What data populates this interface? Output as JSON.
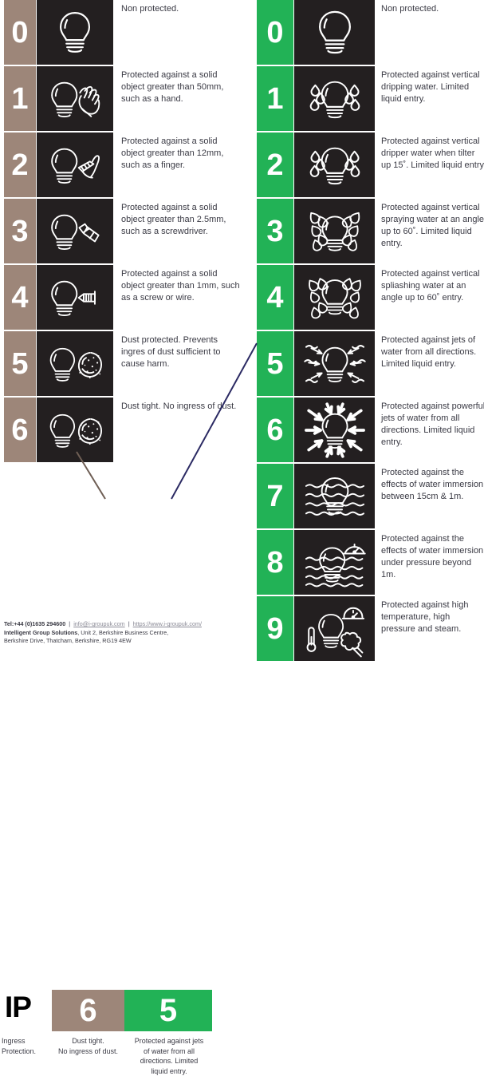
{
  "colors": {
    "brown": "#9d8679",
    "green": "#22b256",
    "tile": "#231f20",
    "text": "#3a3a44",
    "connector_dust": "#6f5f55",
    "connector_water": "#2b2a63",
    "white": "#ffffff",
    "black": "#000000"
  },
  "solids_column": {
    "rows": [
      {
        "digit": "0",
        "icon": "bulb-icon",
        "desc": "Non protected."
      },
      {
        "digit": "1",
        "icon": "bulb-hand-icon",
        "desc": "Protected against a solid object greater than 50mm, such as a hand."
      },
      {
        "digit": "2",
        "icon": "bulb-finger-icon",
        "desc": "Protected against a solid object greater than 12mm, such as a finger."
      },
      {
        "digit": "3",
        "icon": "bulb-screwdriver-icon",
        "desc": "Protected against a solid object greater than 2.5mm, such as a screwdriver."
      },
      {
        "digit": "4",
        "icon": "bulb-screw-icon",
        "desc": "Protected against a solid object greater than 1mm, such as a screw or wire."
      },
      {
        "digit": "5",
        "icon": "bulb-dust-icon",
        "desc": "Dust protected. Prevents ingres of dust sufficient to cause harm."
      },
      {
        "digit": "6",
        "icon": "bulb-dust-icon",
        "desc": "Dust tight. No ingress of dust."
      }
    ]
  },
  "liquids_column": {
    "rows": [
      {
        "digit": "0",
        "icon": "bulb-icon",
        "desc": "Non protected."
      },
      {
        "digit": "1",
        "icon": "bulb-drips-icon",
        "desc": "Protected against vertical dripping water. Limited liquid entry."
      },
      {
        "digit": "2",
        "icon": "bulb-drips-tilt-icon",
        "desc": "Protected against vertical dripper water when tilter up 15˚. Limited liquid entry."
      },
      {
        "digit": "3",
        "icon": "bulb-spray-icon",
        "desc": "Protected against vertical spraying water at an angle up to 60˚. Limited liquid entry."
      },
      {
        "digit": "4",
        "icon": "bulb-splash-icon",
        "desc": "Protected against vertical spliashing water at an angle up to 60˚ entry."
      },
      {
        "digit": "5",
        "icon": "bulb-jets-icon",
        "desc": "Protected against jets of water from all directions. Limited liquid entry."
      },
      {
        "digit": "6",
        "icon": "bulb-powerful-jets-icon",
        "desc": "Protected against powerful jets of water from all directions. Limited liquid entry."
      },
      {
        "digit": "7",
        "icon": "bulb-immersion-icon",
        "desc": "Protected against the effects of water immersion between 15cm & 1m."
      },
      {
        "digit": "8",
        "icon": "bulb-deep-immersion-icon",
        "desc": "Protected against the effects of water immersion under pressure beyond 1m."
      },
      {
        "digit": "9",
        "icon": "bulb-steam-icon",
        "desc": "Protected against high temperature, high pressure and steam."
      }
    ]
  },
  "ip_summary": {
    "prefix": "IP",
    "prefix_caption": "Ingress\nProtection.",
    "dust_digit": "6",
    "dust_caption": "Dust tight.\nNo ingress of dust.",
    "water_digit": "5",
    "water_caption": "Protected against jets\nof water from all\ndirections. Limited\nliquid entry."
  },
  "footer": {
    "tel": "Tel:+44 (0)1635 294600",
    "sep": "|",
    "email": "info@i-groupuk.com",
    "website": "https://www.i-groupuk.com/",
    "company": "Intelligent Group Solutions",
    "address_line1": ", Unit 2, Berkshire Business Centre,",
    "address_line2": "Berkshire Drive, Thatcham, Berkshire, RG19 4EW"
  }
}
